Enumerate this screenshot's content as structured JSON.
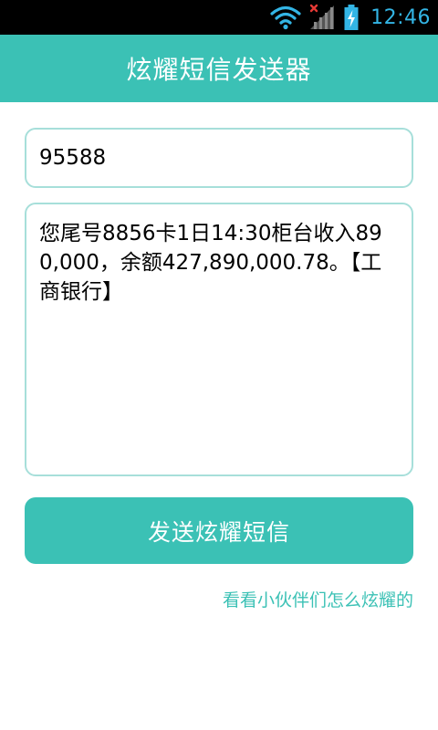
{
  "status_bar": {
    "time": "12:46",
    "icons": [
      "wifi-icon",
      "no-sim-signal-icon",
      "battery-charging-icon"
    ],
    "colors": {
      "background": "#000000",
      "icon_active": "#33b5e5",
      "icon_dim": "#6e6e6e",
      "no_sim_mark": "#e53935"
    }
  },
  "app_bar": {
    "title": "炫耀短信发送器",
    "color": "#3bc1b5"
  },
  "form": {
    "phone_number": "95588",
    "message": "您尾号8856卡1日14:30柜台收入890,000，余额427,890,000.78。【工商银行】",
    "border_color": "#a7dfda"
  },
  "send_button": {
    "label": "发送炫耀短信",
    "color": "#3bc1b5"
  },
  "showcase_link": {
    "label": "看看小伙伴们怎么炫耀的",
    "color": "#3bc1b5"
  }
}
